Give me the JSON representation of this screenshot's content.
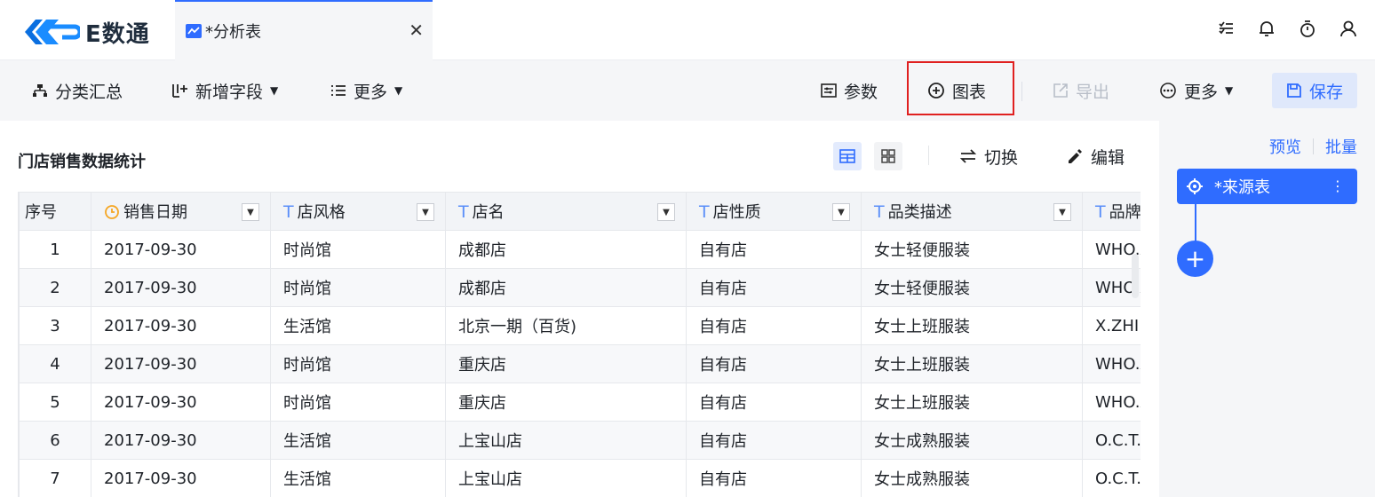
{
  "app": {
    "logo_text": "E数通"
  },
  "tab": {
    "label": "*分析表",
    "close": "✕"
  },
  "toolbar": {
    "group_summary": "分类汇总",
    "add_field": "新增字段",
    "more_left": "更多",
    "params": "参数",
    "chart": "图表",
    "export": "导出",
    "more_right": "更多",
    "save": "保存"
  },
  "panel": {
    "title": "门店销售数据统计",
    "switch": "切换",
    "edit": "编辑"
  },
  "table": {
    "columns": [
      {
        "label": "序号",
        "type": ""
      },
      {
        "label": "销售日期",
        "type": "date"
      },
      {
        "label": "店风格",
        "type": "T"
      },
      {
        "label": "店名",
        "type": "T"
      },
      {
        "label": "店性质",
        "type": "T"
      },
      {
        "label": "品类描述",
        "type": "T"
      },
      {
        "label": "品牌",
        "type": "T"
      }
    ],
    "rows": [
      [
        "1",
        "2017-09-30",
        "时尚馆",
        "成都店",
        "自有店",
        "女士轻便服装",
        "WHO.A"
      ],
      [
        "2",
        "2017-09-30",
        "时尚馆",
        "成都店",
        "自有店",
        "女士轻便服装",
        "WHO.A"
      ],
      [
        "3",
        "2017-09-30",
        "生活馆",
        "北京一期（百货)",
        "自有店",
        "女士上班服装",
        "X.ZHIN"
      ],
      [
        "4",
        "2017-09-30",
        "时尚馆",
        "重庆店",
        "自有店",
        "女士上班服装",
        "WHO.A"
      ],
      [
        "5",
        "2017-09-30",
        "时尚馆",
        "重庆店",
        "自有店",
        "女士上班服装",
        "WHO.A"
      ],
      [
        "6",
        "2017-09-30",
        "生活馆",
        "上宝山店",
        "自有店",
        "女士成熟服装",
        "O.C.T."
      ],
      [
        "7",
        "2017-09-30",
        "生活馆",
        "上宝山店",
        "自有店",
        "女士成熟服装",
        "O.C.T."
      ]
    ]
  },
  "side": {
    "preview": "预览",
    "batch": "批量",
    "node_label": "*来源表",
    "add": "+"
  },
  "colors": {
    "accent": "#2f6cff",
    "highlight": "#e02020"
  }
}
